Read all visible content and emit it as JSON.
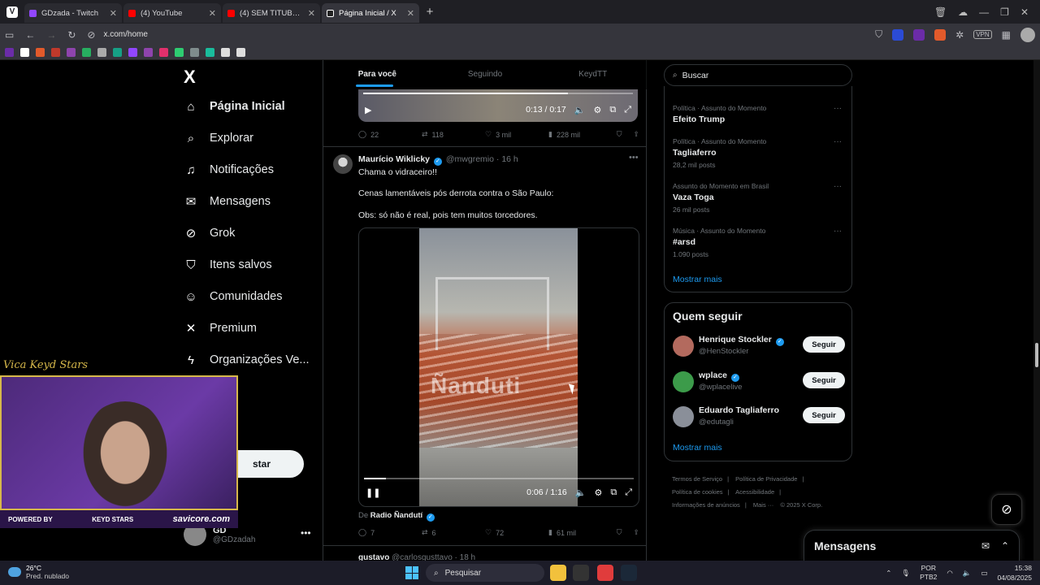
{
  "browser": {
    "tabs": [
      {
        "label": "GDzada - Twitch",
        "color": "#9146ff",
        "active": false
      },
      {
        "label": "(4) YouTube",
        "color": "#ff0000",
        "active": false
      },
      {
        "label": "(4) SEM TITUBEAR - SÃ",
        "color": "#ff0000",
        "active": false
      },
      {
        "label": "Página Inicial / X",
        "color": "#ffffff",
        "active": true
      }
    ],
    "new_tab": "+",
    "url": "x.com/home",
    "vpn_label": "VPN"
  },
  "nav": {
    "logo": "X",
    "items": [
      {
        "label": "Página Inicial",
        "icon": "home-icon"
      },
      {
        "label": "Explorar",
        "icon": "search-icon"
      },
      {
        "label": "Notificações",
        "icon": "bell-icon"
      },
      {
        "label": "Mensagens",
        "icon": "mail-icon"
      },
      {
        "label": "Grok",
        "icon": "grok-icon"
      },
      {
        "label": "Itens salvos",
        "icon": "bookmark-icon"
      },
      {
        "label": "Comunidades",
        "icon": "people-icon"
      },
      {
        "label": "Premium",
        "icon": "x-icon"
      },
      {
        "label": "Organizações Ve...",
        "icon": "bolt-icon"
      }
    ],
    "post_button": "star",
    "profile": {
      "name": "GD",
      "handle": "@GDzadah",
      "more": "•••"
    }
  },
  "feed": {
    "tabs": [
      "Para você",
      "Seguindo",
      "KeydTT"
    ],
    "first_post": {
      "video": {
        "time": "0:13 / 0:17",
        "progress": 0.76
      },
      "stats": {
        "replies": "22",
        "reposts": "118",
        "likes": "3 mil",
        "views": "228 mil"
      }
    },
    "post": {
      "name": "Maurício Wiklicky",
      "handle": "@mwgremio",
      "time": "16 h",
      "lines": [
        "Chama o vidraceiro!!",
        "Cenas lamentáveis pós derrota contra o São Paulo:",
        "Obs: só não é real, pois tem muitos torcedores."
      ],
      "video": {
        "time": "0:06 / 1:16",
        "progress": 0.08,
        "watermark": "Ñanduti"
      },
      "source_prefix": "De",
      "source_name": "Radio Ñandutí",
      "stats": {
        "replies": "7",
        "reposts": "6",
        "likes": "72",
        "views": "61 mil"
      }
    },
    "next_post": {
      "name": "gustavo",
      "handle": "@carlosgusttavo",
      "time": "18 h"
    }
  },
  "sidebar": {
    "search_placeholder": "Buscar",
    "trends": [
      {
        "category": "Política · Assunto do Momento",
        "title": "Efeito Trump",
        "count": ""
      },
      {
        "category": "Política · Assunto do Momento",
        "title": "Tagliaferro",
        "count": "28,2 mil posts"
      },
      {
        "category": "Assunto do Momento em Brasil",
        "title": "Vaza Toga",
        "count": "26 mil posts"
      },
      {
        "category": "Música · Assunto do Momento",
        "title": "#arsd",
        "count": "1.090 posts"
      }
    ],
    "show_more": "Mostrar mais",
    "who_to_follow": {
      "title": "Quem seguir",
      "users": [
        {
          "name": "Henrique Stockler",
          "handle": "@HenStockler",
          "button": "Seguir",
          "verified": true,
          "color": "#b36a5e"
        },
        {
          "name": "wplace",
          "handle": "@wplacelive",
          "button": "Seguir",
          "verified": true,
          "color": "#3c9b4a"
        },
        {
          "name": "Eduardo Tagliaferro",
          "handle": "@edutagli",
          "button": "Seguir",
          "verified": false,
          "color": "#8a8f99"
        }
      ],
      "show_more": "Mostrar mais"
    },
    "footer": [
      "Termos de Serviço",
      "|",
      "Política de Privacidade",
      "|",
      "Política de cookies",
      "|",
      "Acessibilidade",
      "|",
      "Informações de anúncios",
      "|",
      "Mais ···",
      "© 2025 X Corp."
    ]
  },
  "messages_drawer": {
    "title": "Mensagens"
  },
  "webcam": {
    "signature": "Vica Keyd Stars",
    "powered_by": "POWERED BY",
    "brand": "KEYD STARS",
    "sponsor": "savicore.com"
  },
  "taskbar": {
    "temp": "26°C",
    "weather": "Pred. nublado",
    "search": "Pesquisar",
    "lang_top": "POR",
    "lang_bottom": "PTB2",
    "time": "15:38",
    "date": "04/08/2025"
  }
}
